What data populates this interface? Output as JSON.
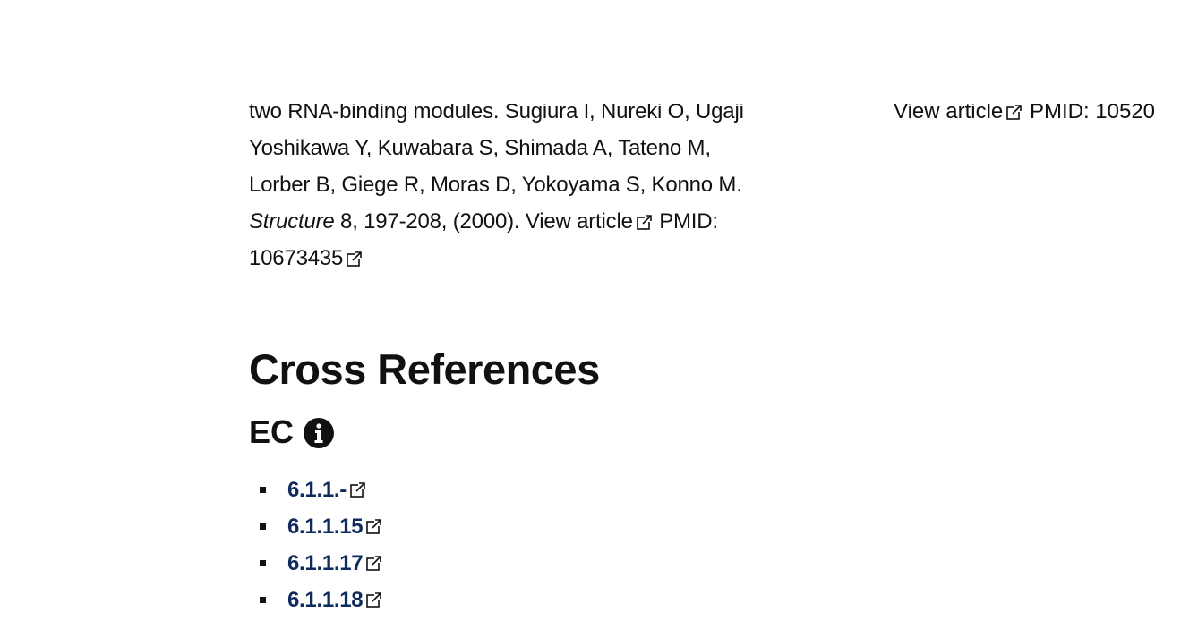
{
  "citation": {
    "line1_partial": "two RNA-binding modules. Sugiura I, Nureki O, Ugaji",
    "line2": "Yoshikawa Y, Kuwabara S, Shimada A, Tateno M,",
    "line3": "Lorber B, Giege R, Moras D, Yokoyama S, Konno M.",
    "journal": "Structure",
    "details": " 8, 197-208, (2000). ",
    "view_article": "View article",
    "pmid_label": "PMID:",
    "pmid_value": "10673435"
  },
  "right_citation": {
    "view_article": "View article",
    "pmid_partial": "PMID: 10520"
  },
  "cross_references": {
    "title": "Cross References",
    "ec_heading": "EC",
    "info_icon": "info-circle-icon",
    "ec_numbers": [
      "6.1.1.-",
      "6.1.1.15",
      "6.1.1.17",
      "6.1.1.18"
    ]
  },
  "colors": {
    "link": "#0f2a5c",
    "text": "#111111"
  }
}
